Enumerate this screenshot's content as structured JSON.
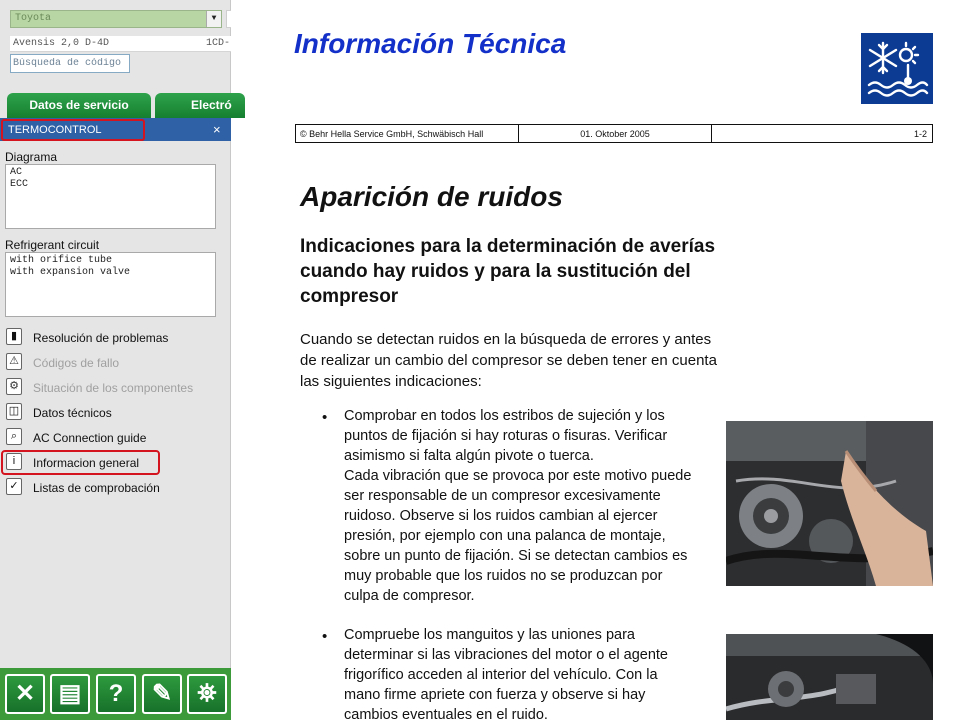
{
  "sidebar": {
    "vehicle_make": "Toyota",
    "vehicle_model": "Avensis 2,0 D-4D",
    "engine_code": "1CD-",
    "code_search_placeholder": "Búsqueda de código",
    "tabs": [
      {
        "label": "Datos de servicio"
      },
      {
        "label": "Electró"
      }
    ],
    "panel": {
      "title": "TERMOCONTROL",
      "close": "×"
    },
    "diagram": {
      "label": "Diagrama",
      "items": [
        "AC",
        "ECC"
      ]
    },
    "refrigerant": {
      "label": "Refrigerant circuit",
      "items": [
        "with orifice tube",
        "with expansion valve"
      ]
    },
    "menu": [
      {
        "label": "Resolución de problemas",
        "icon": "tools-icon",
        "enabled": true
      },
      {
        "label": "Códigos de fallo",
        "icon": "warning-icon",
        "enabled": false
      },
      {
        "label": "Situación de los componentes",
        "icon": "car-icon",
        "enabled": false
      },
      {
        "label": "Datos técnicos",
        "icon": "book-icon",
        "enabled": true
      },
      {
        "label": "AC Connection guide",
        "icon": "search-icon",
        "enabled": true
      },
      {
        "label": "Informacion general",
        "icon": "info-icon",
        "enabled": true
      },
      {
        "label": "Listas de comprobación",
        "icon": "checkmark-icon",
        "enabled": true
      }
    ],
    "toolbar": [
      {
        "icon": "close-icon",
        "glyph": "✕"
      },
      {
        "icon": "print-icon",
        "glyph": "▤"
      },
      {
        "icon": "help-icon",
        "glyph": "?"
      },
      {
        "icon": "notes-icon",
        "glyph": "✎"
      },
      {
        "icon": "binoculars-icon",
        "glyph": "⛯"
      }
    ]
  },
  "document": {
    "title": "Información Técnica",
    "header": {
      "copyright": "© Behr Hella Service GmbH, Schwäbisch Hall",
      "date": "01. Oktober 2005",
      "page": "1-2"
    },
    "heading": "Aparición de ruidos",
    "subheading": "Indicaciones para la determinación de averías cuando hay ruidos y para la sustitución del compresor",
    "intro": "Cuando se detectan ruidos en la búsqueda de errores y antes de realizar un cambio del compresor se deben tener en cuenta las siguientes indicaciones:",
    "bullets": [
      {
        "lines": [
          "Comprobar en todos los estribos de sujeción y los",
          "puntos de fijación si hay roturas o fisuras. Verificar",
          "asimismo si falta algún pivote o tuerca.",
          "Cada vibración que se provoca por este motivo puede",
          "ser responsable de un compresor excesivamente",
          "ruidoso. Observe si los ruidos cambian al ejercer",
          "presión, por ejemplo con una palanca de montaje,",
          "sobre un punto de fijación. Si se detectan cambios es",
          "muy probable que los ruidos no se produzcan por",
          "culpa de compresor."
        ]
      },
      {
        "lines": [
          "Compruebe los manguitos y las uniones para",
          "determinar si las vibraciones del motor o el agente",
          "frigorífico acceden al interior del vehículo. Con la",
          "mano firme apriete con fuerza y observe si hay",
          "cambios eventuales en el ruido."
        ]
      }
    ],
    "bullet_symbol": "•"
  },
  "colors": {
    "accent_green": "#1e8f37",
    "panel_blue": "#2f61a6",
    "highlight_red": "#d4141e",
    "title_blue": "#1330c8",
    "logo_blue": "#0c3b93"
  }
}
